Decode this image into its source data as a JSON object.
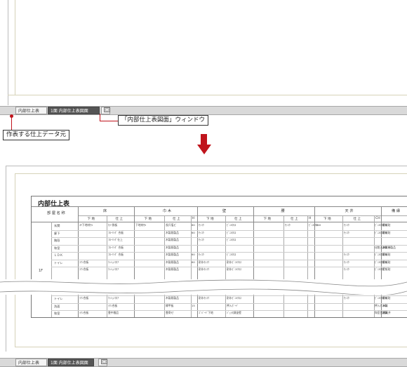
{
  "top_tabs": {
    "tab1": "内部仕上表",
    "tab2": "1面 内部仕上表図面",
    "tab3_icon": "drawing-sheet-icon"
  },
  "callouts": {
    "window": "「内部仕上表図面」ウィンドウ",
    "source": "作表する仕上データ元"
  },
  "table": {
    "title": "内部仕上表",
    "room_header": "部 屋 名 称",
    "groups": {
      "floor": "床",
      "baseboard": "巾 木",
      "wall": "壁",
      "waist": "腰",
      "ceiling": "天 井",
      "remarks": "備 縁"
    },
    "sub": {
      "shita": "下 地",
      "shiage": "仕 上",
      "h": "H",
      "ch": "CH"
    },
    "floor_label": "1F",
    "rooms_upper": [
      "玄関",
      "廊下",
      "階段",
      "和室",
      "ＬＤＫ",
      "トイレ"
    ],
    "rooms_lower": [
      "トイレ",
      "洗面",
      "和室"
    ],
    "rows_upper": [
      [
        "ｽｷ下地材ｾﾙ",
        "ｶﾗｰ鉄板",
        "下地材ｾﾙ",
        "長尺塩ビ",
        "60",
        "ｾｯｺｳ",
        "ﾋﾞﾆﾙｸﾛｽ",
        "",
        "ｾｯｺｳ",
        "ﾋﾞﾆﾙｸﾛｽ",
        "240",
        "ｾｯｺｳ",
        "ﾋﾞﾆﾙｸﾛｽ",
        "240",
        "壁紙貼"
      ],
      [
        "",
        "ﾌﾛｰﾘﾝｸﾞ 合板",
        "",
        "木製既製品",
        "60",
        "ｾｯｺｳ",
        "ﾋﾞﾆﾙｸﾛｽ",
        "",
        "",
        "",
        "",
        "ｾｯｺｳ",
        "ﾋﾞﾆﾙｸﾛｽ",
        "240",
        "壁紙貼"
      ],
      [
        "",
        "ﾌﾛｰﾘﾝｸﾞ仕上",
        "",
        "木製既製品",
        "",
        "ｾｯｺｳ",
        "ﾋﾞﾆﾙｸﾛｽ",
        "",
        "",
        "",
        "",
        "",
        "",
        "",
        ""
      ],
      [
        "",
        "ﾌﾛｰﾘﾝｸﾞ 合板",
        "",
        "木製既製品",
        "",
        "",
        "",
        "",
        "",
        "",
        "",
        "",
        "化粧天井ﾎﾞｰﾄﾞ",
        "240",
        "木製既製品"
      ],
      [
        "",
        "ﾌﾛｰﾘﾝｸﾞ 合板",
        "",
        "木製既製品",
        "60",
        "ｾｯｺｳ",
        "ﾋﾞﾆﾙｸﾛｽ",
        "",
        "",
        "",
        "",
        "ｾｯｺｳ",
        "ﾋﾞﾆﾙｸﾛｽ",
        "240",
        "壁紙貼"
      ],
      [
        "ﾗﾜﾝ合板",
        "ｸｯｼｮﾝﾌﾛｱ",
        "",
        "木製既製品",
        "60",
        "耐水ｾｯｺｳ",
        "耐水ﾋﾞﾆﾙｸﾛｽ",
        "",
        "",
        "",
        "",
        "ｾｯｺｳ",
        "ﾋﾞﾆﾙｸﾛｽ",
        "240",
        "壁紙貼"
      ],
      [
        "ﾗﾜﾝ合板",
        "ｸｯｼｮﾝﾌﾛｱ",
        "",
        "木製既製品",
        "",
        "耐水ｾｯｺｳ",
        "耐水ﾋﾞﾆﾙｸﾛｽ",
        "",
        "",
        "",
        "",
        "ｾｯｺｳ",
        "ﾋﾞﾆﾙｸﾛｽ",
        "",
        "壁紙貼"
      ]
    ],
    "rows_lower": [
      [
        "ﾗﾜﾝ合板",
        "ｸｯｼｮﾝﾌﾛｱ",
        "",
        "木製既製品",
        "",
        "耐水ｾｯｺｳ",
        "耐水ﾋﾞﾆﾙｸﾛｽ",
        "",
        "",
        "",
        "",
        "ｾｯｺｳ",
        "ﾋﾞﾆﾙｸﾛｽ",
        "240",
        "壁紙貼"
      ],
      [
        "",
        "ﾗﾜﾝ合板",
        "",
        "縁甲板",
        "15",
        "",
        "押入ﾎﾞｰﾄﾞ",
        "",
        "",
        "",
        "",
        "",
        "押入ﾎﾞｰﾄﾞ",
        "240",
        "木製"
      ],
      [
        "ﾗﾜﾝ合板",
        "畳中間品",
        "",
        "畳寄せ",
        "",
        "ｺﾞﾊﾞｰﾄﾞ下地",
        "ｼﾞｭﾗｸ調塗壁",
        "",
        "",
        "",
        "",
        "",
        "和室目透天井",
        "240",
        "木製"
      ]
    ]
  },
  "bottom_tabs": {
    "tab1": "内部仕上表",
    "tab2": "1面 内部仕上表図面",
    "tab3_icon": "drawing-sheet-icon"
  },
  "colors": {
    "accent": "#c0141c",
    "active_tab": "#555555",
    "tabbar": "#d9d9d9"
  }
}
